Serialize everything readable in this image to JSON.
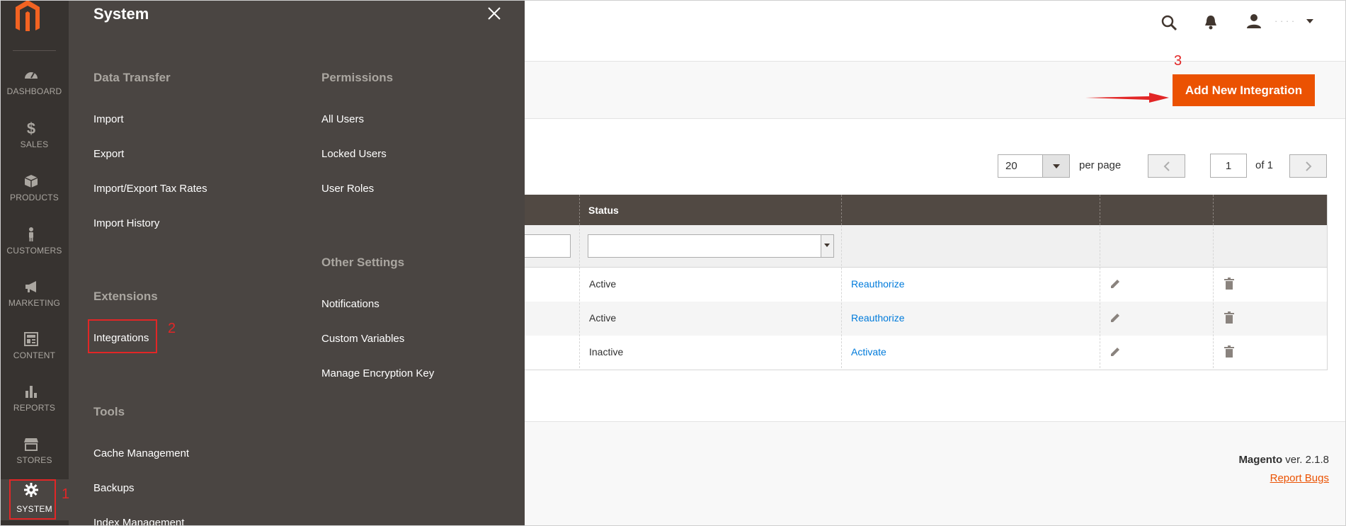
{
  "nav": {
    "items": [
      {
        "label": "DASHBOARD",
        "icon": "dashboard-icon"
      },
      {
        "label": "SALES",
        "icon": "dollar-icon"
      },
      {
        "label": "PRODUCTS",
        "icon": "box-icon"
      },
      {
        "label": "CUSTOMERS",
        "icon": "person-icon"
      },
      {
        "label": "MARKETING",
        "icon": "megaphone-icon"
      },
      {
        "label": "CONTENT",
        "icon": "layout-icon"
      },
      {
        "label": "REPORTS",
        "icon": "bar-chart-icon"
      },
      {
        "label": "STORES",
        "icon": "storefront-icon"
      },
      {
        "label": "SYSTEM",
        "icon": "gear-icon"
      }
    ]
  },
  "flyout": {
    "title": "System",
    "sections": {
      "data_transfer": {
        "title": "Data Transfer",
        "items": [
          "Import",
          "Export",
          "Import/Export Tax Rates",
          "Import History"
        ]
      },
      "extensions": {
        "title": "Extensions",
        "items": [
          "Integrations"
        ]
      },
      "tools": {
        "title": "Tools",
        "items": [
          "Cache Management",
          "Backups",
          "Index Management"
        ]
      },
      "permissions": {
        "title": "Permissions",
        "items": [
          "All Users",
          "Locked Users",
          "User Roles"
        ]
      },
      "other_settings": {
        "title": "Other Settings",
        "items": [
          "Notifications",
          "Custom Variables",
          "Manage Encryption Key"
        ]
      }
    }
  },
  "annotations": {
    "a1": "1",
    "a2": "2",
    "a3": "3"
  },
  "header": {
    "user_name": "· · · ·"
  },
  "actions": {
    "add_new_label": "Add New Integration"
  },
  "pager": {
    "per_page_value": "20",
    "per_page_label": "per page",
    "current_page": "1",
    "of_label": "of 1"
  },
  "grid": {
    "columns": [
      "Status"
    ],
    "rows": [
      {
        "status": "Active",
        "action": "Reauthorize"
      },
      {
        "status": "Active",
        "action": "Reauthorize"
      },
      {
        "status": "Inactive",
        "action": "Activate"
      }
    ]
  },
  "footer": {
    "brand": "Magento",
    "version": "ver. 2.1.8",
    "report_bugs": "Report Bugs"
  },
  "colors": {
    "accent": "#eb5202",
    "nav_bg": "#373330",
    "flyout_bg": "#4a4542",
    "link": "#007bdb",
    "annotation": "#e22626"
  }
}
